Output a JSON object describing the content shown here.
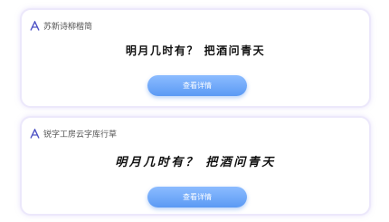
{
  "cards": [
    {
      "font_name": "苏新诗柳楷简",
      "preview_text": "明月几时有？ 把酒问青天",
      "button_label": "查看详情",
      "icon": "font-a-icon"
    },
    {
      "font_name": "锐字工房云字库行草",
      "preview_text": "明月几时有？ 把酒问青天",
      "button_label": "查看详情",
      "icon": "font-a-icon"
    }
  ],
  "colors": {
    "accent": "#5b9af4",
    "icon": "#4b4fc4",
    "card_border": "#ece8fb"
  }
}
